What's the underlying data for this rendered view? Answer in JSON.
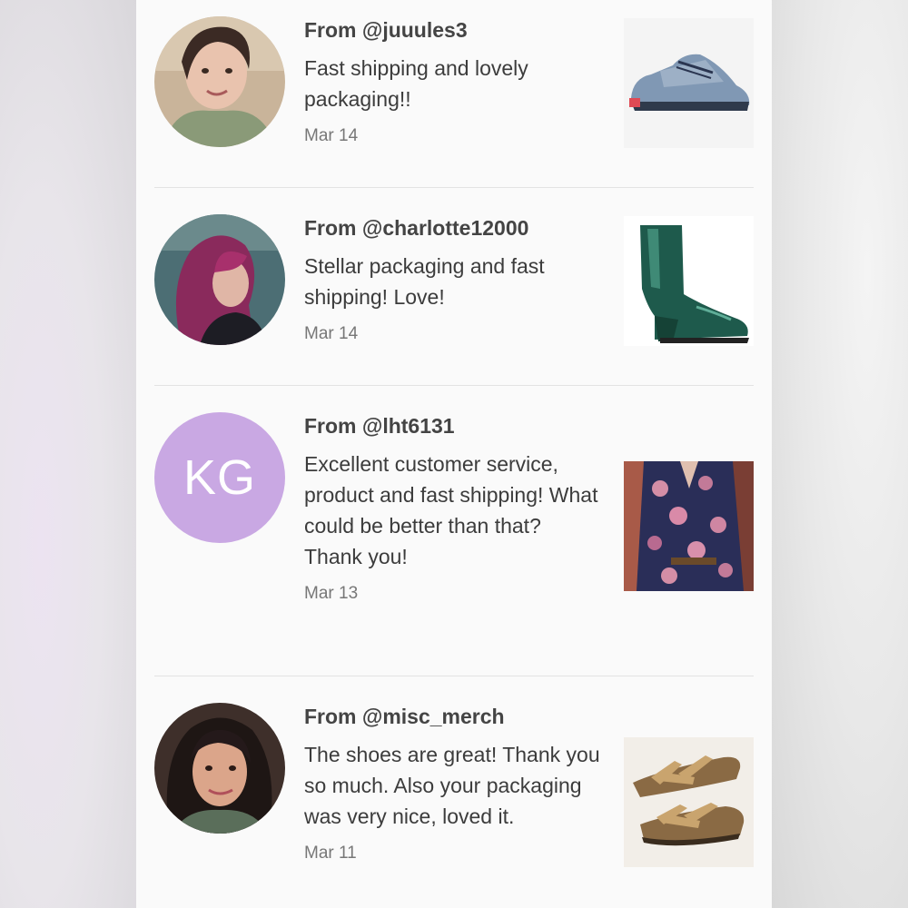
{
  "reviews": [
    {
      "from": "From @juuules3",
      "message": "Fast shipping and lovely packaging!!",
      "date": "Mar 14",
      "avatar_icon": "user-photo",
      "product_icon": "hiking-sneaker"
    },
    {
      "from": "From @charlotte12000",
      "message": "Stellar packaging and fast shipping! Love!",
      "date": "Mar 14",
      "avatar_icon": "user-photo",
      "product_icon": "green-patent-ankle-boot"
    },
    {
      "from": "From @lht6131",
      "message": "Excellent customer service, product and fast shipping! What could be better than that? Thank you!",
      "date": "Mar 13",
      "avatar_initials": "KG",
      "avatar_color": "#c9a8e3",
      "product_icon": "floral-blouse"
    },
    {
      "from": "From @misc_merch",
      "message": "The shoes are great! Thank you so much. Also your packaging was very nice, loved it.",
      "date": "Mar 11",
      "avatar_icon": "user-photo",
      "product_icon": "wedge-sandals"
    }
  ]
}
